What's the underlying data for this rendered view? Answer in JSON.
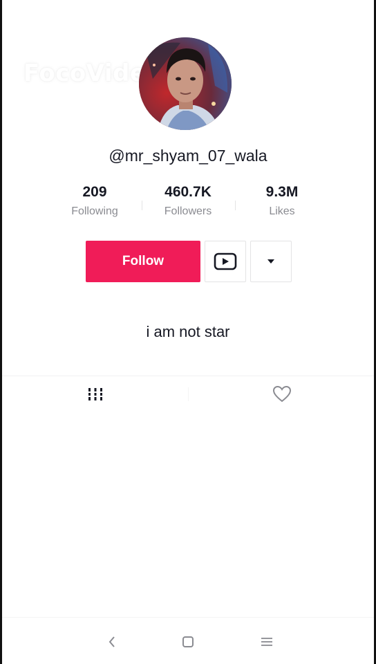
{
  "watermark": "FocoVideo",
  "profile": {
    "username": "@mr_shyam_07_wala",
    "bio": "i am not star"
  },
  "stats": [
    {
      "value": "209",
      "label": "Following"
    },
    {
      "value": "460.7K",
      "label": "Followers"
    },
    {
      "value": "9.3M",
      "label": "Likes"
    }
  ],
  "actions": {
    "follow_label": "Follow",
    "video_icon": "youtube-icon",
    "more_icon": "dropdown-arrow-icon"
  },
  "tabs": [
    {
      "icon": "grid-videos-icon"
    },
    {
      "icon": "heart-icon"
    }
  ],
  "system_nav": {
    "back_icon": "back-icon",
    "home_icon": "home-icon",
    "menu_icon": "menu-icon"
  },
  "colors": {
    "accent": "#f01c58",
    "text_primary": "#161823",
    "text_secondary": "#8a8b91"
  }
}
